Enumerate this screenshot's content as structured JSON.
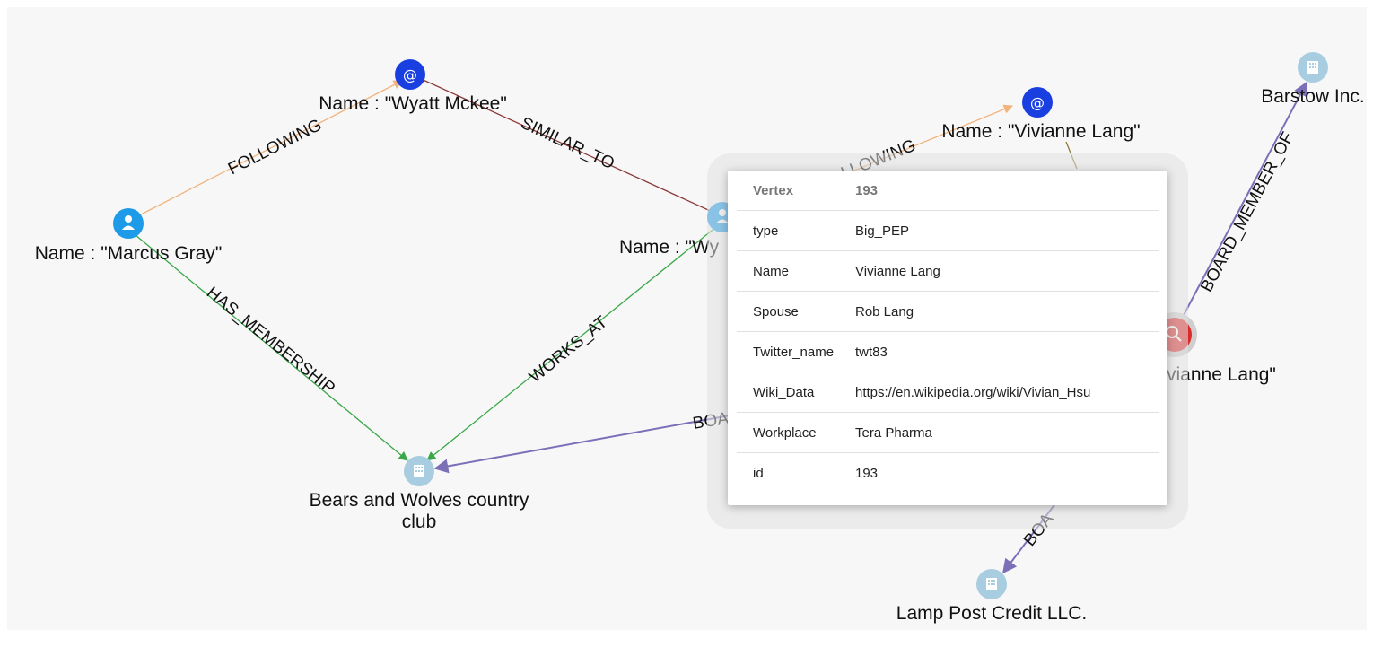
{
  "nodes": {
    "wyatt_mckee": {
      "label": "Name : \"Wyatt Mckee\"",
      "icon": "at-icon",
      "color": "#1a3fe0"
    },
    "marcus_gray": {
      "label": "Name : \"Marcus Gray\"",
      "icon": "person-icon",
      "color": "#1e9be8"
    },
    "wyatt_center": {
      "label": "Name : \"Wy",
      "icon": "person-icon",
      "color": "#1e9be8"
    },
    "vivianne_email": {
      "label": "Name : \"Vivianne Lang\"",
      "icon": "at-icon",
      "color": "#1a3fe0"
    },
    "vivianne_pep": {
      "label": "vianne Lang\"",
      "icon": "person-search-icon",
      "color": "#d92b2b"
    },
    "barstow": {
      "label": "Barstow Inc.",
      "icon": "building-icon",
      "color": "#a8cde0"
    },
    "bears_wolves": {
      "label_line1": "Bears and Wolves country",
      "label_line2": "club",
      "icon": "building-icon",
      "color": "#a8cde0"
    },
    "lamp_post": {
      "label": "Lamp Post Credit LLC.",
      "icon": "building-icon",
      "color": "#a8cde0"
    }
  },
  "edges": {
    "following_1": {
      "label": "FOLLOWING",
      "color": "#f2b27a"
    },
    "similar_to": {
      "label": "SIMILAR_TO",
      "color": "#8c3a3a"
    },
    "has_membership": {
      "label": "HAS_MEMBERSHIP",
      "color": "#3aa84a"
    },
    "works_at": {
      "label": "WORKS_AT",
      "color": "#3aa84a"
    },
    "following_2": {
      "label": "LLOWING",
      "color": "#f2b27a"
    },
    "board_member_of": {
      "label": "BOARD_MEMBER_OF",
      "color": "#7b6fb8"
    },
    "board_left": {
      "label": "BOA",
      "color": "#7b6fb8"
    },
    "board_bottom": {
      "label": "BOA",
      "color": "#7b6fb8"
    },
    "spouse_link": {
      "label": "",
      "color": "#8c7a3a"
    }
  },
  "popup": {
    "rows": [
      {
        "key": "Vertex",
        "value": "193"
      },
      {
        "key": "type",
        "value": "Big_PEP"
      },
      {
        "key": "Name",
        "value": "Vivianne Lang"
      },
      {
        "key": "Spouse",
        "value": "Rob Lang"
      },
      {
        "key": "Twitter_name",
        "value": "twt83"
      },
      {
        "key": "Wiki_Data",
        "value": "https://en.wikipedia.org/wiki/Vivian_Hsu"
      },
      {
        "key": "Workplace",
        "value": "Tera Pharma"
      },
      {
        "key": "id",
        "value": "193"
      }
    ]
  }
}
